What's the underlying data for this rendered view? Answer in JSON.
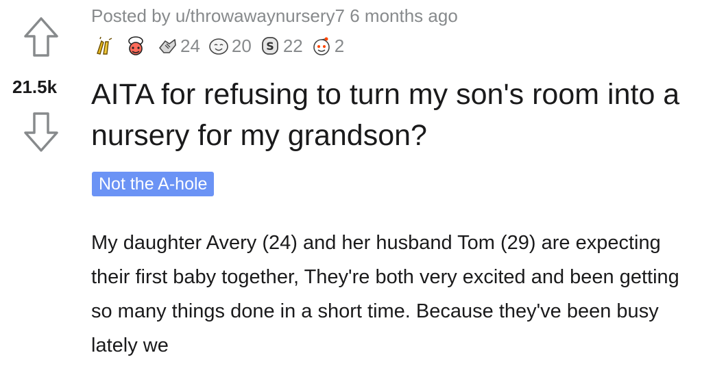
{
  "post": {
    "score": "21.5k",
    "meta": {
      "prefix": "Posted by",
      "username": "u/throwawaynursery7",
      "time": "6 months ago"
    },
    "awards": [
      {
        "icon": "praise-hands-icon",
        "count": ""
      },
      {
        "icon": "wholesome-chef-icon",
        "count": ""
      },
      {
        "icon": "handshake-icon",
        "count": "24"
      },
      {
        "icon": "wholesome-smile-icon",
        "count": "20"
      },
      {
        "icon": "silver-coin-icon",
        "count": "22"
      },
      {
        "icon": "helpful-face-icon",
        "count": "2"
      }
    ],
    "title": "AITA for refusing to turn my son's room into a nursery for my grandson?",
    "flair": "Not the A-hole",
    "body": "My daughter Avery (24) and her husband Tom (29) are expecting their first baby together, They're both very excited and been getting so many things done in a short time. Because they've been busy lately we"
  },
  "colors": {
    "flair_bg": "#6b93f5",
    "meta_text": "#878a8c",
    "title_text": "#1a1a1b"
  }
}
